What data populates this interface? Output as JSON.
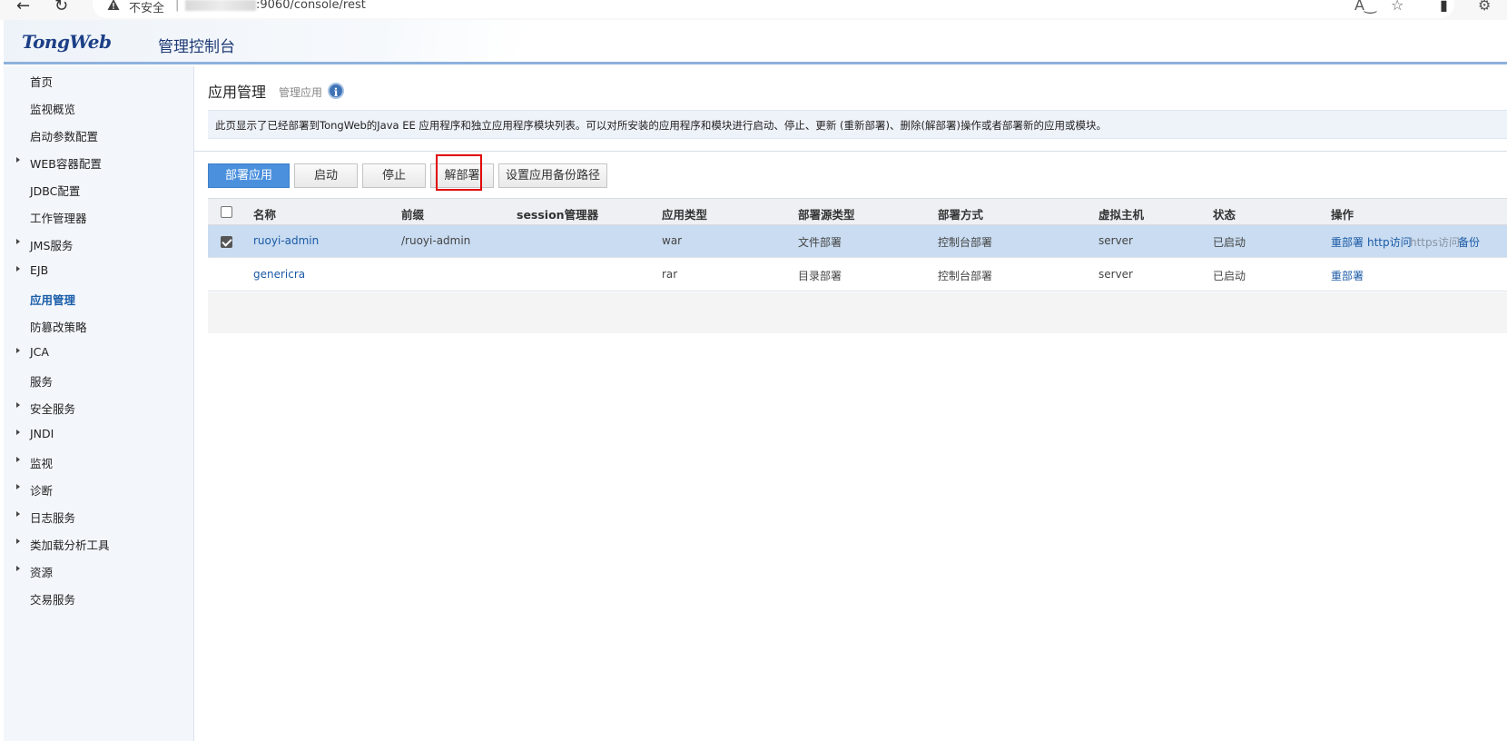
{
  "browser": {
    "insecure_label": "不安全",
    "separator": "|",
    "url_visible": ":9060/console/rest"
  },
  "header": {
    "logo_text": "TongWeb",
    "console_title": "管理控制台"
  },
  "sidebar": {
    "items": [
      {
        "label": "首页",
        "expandable": false,
        "active": false
      },
      {
        "label": "监视概览",
        "expandable": false,
        "active": false
      },
      {
        "label": "启动参数配置",
        "expandable": false,
        "active": false
      },
      {
        "label": "WEB容器配置",
        "expandable": true,
        "active": false
      },
      {
        "label": "JDBC配置",
        "expandable": false,
        "active": false
      },
      {
        "label": "工作管理器",
        "expandable": false,
        "active": false
      },
      {
        "label": "JMS服务",
        "expandable": true,
        "active": false
      },
      {
        "label": "EJB",
        "expandable": true,
        "active": false
      },
      {
        "label": "应用管理",
        "expandable": false,
        "active": true
      },
      {
        "label": "防篡改策略",
        "expandable": false,
        "active": false
      },
      {
        "label": "JCA",
        "expandable": true,
        "active": false
      },
      {
        "label": "服务",
        "expandable": false,
        "active": false
      },
      {
        "label": "安全服务",
        "expandable": true,
        "active": false
      },
      {
        "label": "JNDI",
        "expandable": true,
        "active": false
      },
      {
        "label": "监视",
        "expandable": true,
        "active": false
      },
      {
        "label": "诊断",
        "expandable": true,
        "active": false
      },
      {
        "label": "日志服务",
        "expandable": true,
        "active": false
      },
      {
        "label": "类加载分析工具",
        "expandable": true,
        "active": false
      },
      {
        "label": "资源",
        "expandable": true,
        "active": false
      },
      {
        "label": "交易服务",
        "expandable": false,
        "active": false
      }
    ]
  },
  "main": {
    "title": "应用管理",
    "subtitle": "管理应用",
    "info_glyph": "i",
    "description": "此页显示了已经部署到TongWeb的Java EE 应用程序和独立应用程序模块列表。可以对所安装的应用程序和模块进行启动、停止、更新 (重新部署)、删除(解部署)操作或者部署新的应用或模块。"
  },
  "toolbar": {
    "deploy": "部署应用",
    "start": "启动",
    "stop": "停止",
    "undeploy": "解部署",
    "backup_path": "设置应用备份路径"
  },
  "table": {
    "columns": [
      "名称",
      "前缀",
      "session管理器",
      "应用类型",
      "部署源类型",
      "部署方式",
      "虚拟主机",
      "状态",
      "操作"
    ],
    "rows": [
      {
        "selected": true,
        "name": "ruoyi-admin",
        "prefix": "/ruoyi-admin",
        "session_manager": "",
        "app_type": "war",
        "source_type": "文件部署",
        "deploy_method": "控制台部署",
        "virtual_host": "server",
        "status": "已启动",
        "actions": {
          "redeploy": "重部署",
          "http": "http访问",
          "https": "https访问",
          "backup": "备份"
        }
      },
      {
        "selected": false,
        "name": "genericra",
        "prefix": "",
        "session_manager": "",
        "app_type": "rar",
        "source_type": "目录部署",
        "deploy_method": "控制台部署",
        "virtual_host": "server",
        "status": "已启动",
        "actions": {
          "redeploy": "重部署"
        }
      }
    ]
  },
  "colors": {
    "primary_button": "#4a90dd",
    "selected_row": "#c9dcf1",
    "link": "#1b5aa6",
    "highlight": "#e00000"
  }
}
